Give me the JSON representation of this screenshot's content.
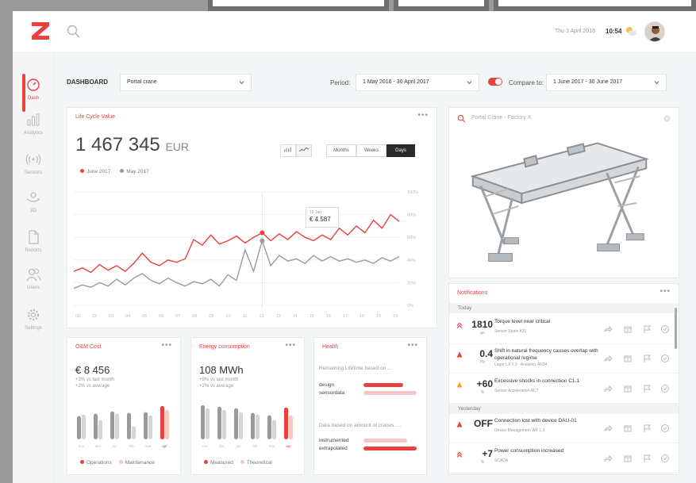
{
  "colors": {
    "accent": "#e8413e",
    "secondary": "#9a9a9a",
    "light_accent": "#f5c7c6",
    "light_secondary": "#d5d5d5",
    "warning": "#f5a623"
  },
  "header": {
    "date": "Thu 3 April 2018",
    "time": "10:54"
  },
  "sidebar": {
    "items": [
      {
        "label": "Dash",
        "icon": "speedometer-icon"
      },
      {
        "label": "Analytics",
        "icon": "bar-chart-icon"
      },
      {
        "label": "Sensors",
        "icon": "signal-icon"
      },
      {
        "label": "3D",
        "icon": "rotate-3d-icon"
      },
      {
        "label": "Reports",
        "icon": "document-icon"
      },
      {
        "label": "Users",
        "icon": "users-icon"
      },
      {
        "label": "Settings",
        "icon": "gear-icon"
      }
    ]
  },
  "controls": {
    "dashboard_label": "DASHBOARD",
    "asset": "Portal crane",
    "period_label": "Period:",
    "period": "1 May 2016 - 30 April 2017",
    "compare_label": "Compare to:",
    "compare": "1 June 2017 - 30 June 2017"
  },
  "lifecycle": {
    "title": "Life Cycle Value",
    "value": "1 467 345",
    "unit": "EUR",
    "granularity": [
      "Months",
      "Weeks",
      "Days"
    ],
    "tooltip_date": "15 Jan",
    "tooltip_value": "€ 4.587"
  },
  "chart_data": {
    "type": "line",
    "x": [
      "01",
      "02",
      "03",
      "04",
      "05",
      "06",
      "07",
      "08",
      "09",
      "10",
      "11",
      "12",
      "13",
      "14",
      "15",
      "16",
      "17",
      "18",
      "19",
      "19"
    ],
    "series": [
      {
        "name": "June 2017",
        "color": "#e8413e",
        "values": [
          30,
          33,
          29,
          36,
          31,
          35,
          30,
          37,
          46,
          38,
          35,
          40,
          38,
          41,
          58,
          53,
          62,
          54,
          57,
          61,
          55,
          60,
          64,
          57,
          63,
          58,
          65,
          60,
          57,
          62,
          58,
          68,
          62,
          70,
          64,
          75,
          68,
          80,
          74
        ]
      },
      {
        "name": "May 2017",
        "color": "#9a9a9a",
        "values": [
          15,
          18,
          16,
          20,
          17,
          23,
          18,
          24,
          28,
          22,
          19,
          24,
          20,
          17,
          21,
          19,
          23,
          17,
          27,
          22,
          49,
          30,
          57,
          35,
          44,
          39,
          41,
          37,
          44,
          39,
          43,
          39,
          41,
          38,
          40,
          37,
          42,
          39,
          43
        ]
      }
    ],
    "y_ticks": [
      "100%",
      "80%",
      "60%",
      "40%",
      "20%",
      "0%"
    ],
    "ylim": [
      0,
      100
    ],
    "highlight_index": 22
  },
  "om": {
    "title": "O&M Cost",
    "value": "€ 8 456",
    "sub1": "+3% vs last month",
    "sub2": "+2% vs average",
    "categories": [
      "nov",
      "dec",
      "jan",
      "feb",
      "mar",
      "apr"
    ],
    "series": [
      {
        "name": "Operations",
        "values": [
          60,
          66,
          72,
          68,
          70,
          86
        ]
      },
      {
        "name": "Maintenance",
        "values": [
          64,
          50,
          66,
          34,
          62,
          76
        ]
      }
    ]
  },
  "energy": {
    "title": "Energy consumption",
    "value": "108 MWh",
    "sub1": "+9% vs last month",
    "sub2": "+2% vs average",
    "categories": [
      "nov",
      "dec",
      "jan",
      "feb",
      "mar",
      "apr"
    ],
    "series": [
      {
        "name": "Measured",
        "values": [
          88,
          84,
          80,
          68,
          62,
          82
        ]
      },
      {
        "name": "Theoretical",
        "values": [
          80,
          76,
          70,
          64,
          50,
          62
        ]
      }
    ]
  },
  "health": {
    "title": "Health",
    "section1": "Remaining Lifetime based on ...",
    "rows1": [
      {
        "label": "design",
        "value": 0.72,
        "strong": true
      },
      {
        "label": "sensordata",
        "value": 0.95,
        "strong": false
      }
    ],
    "section2": "Data based on amount of cranes ....",
    "rows2": [
      {
        "label": "instrumented",
        "value": 0.78,
        "strong": false
      },
      {
        "label": "extrapolated",
        "value": 0.95,
        "strong": true
      }
    ]
  },
  "asset3d": {
    "search": "Portal Crane - Factory X"
  },
  "notifications": {
    "title": "Notifications",
    "today": "Today",
    "yesterday": "Yesterday",
    "items": [
      {
        "value": "1810",
        "unit": "µɛ",
        "title": "Torque level near critical",
        "source": "Sensor Strain A31",
        "icon": "double-chevron-up-icon"
      },
      {
        "value": "0.4",
        "unit": "Hz",
        "title": "Shift in natural frequency causes overlap with operational regime",
        "source": "Lager LX 1.9 - Analytics AN34",
        "icon": "warning-triangle-icon"
      },
      {
        "value": "+60",
        "unit": "%",
        "title": "Excessive shocks in connection C1.1",
        "source": "Sensor Acceleration AC7",
        "icon": "warning-triangle-icon"
      },
      {
        "value": "OFF",
        "unit": "",
        "title": "Connection lost with device DAU-01",
        "source": "Device Management WT 1.3",
        "icon": "warning-triangle-icon"
      },
      {
        "value": "+7",
        "unit": "%",
        "title": "Power consumption increased",
        "source": "SCADA",
        "icon": "double-chevron-up-icon"
      }
    ]
  }
}
